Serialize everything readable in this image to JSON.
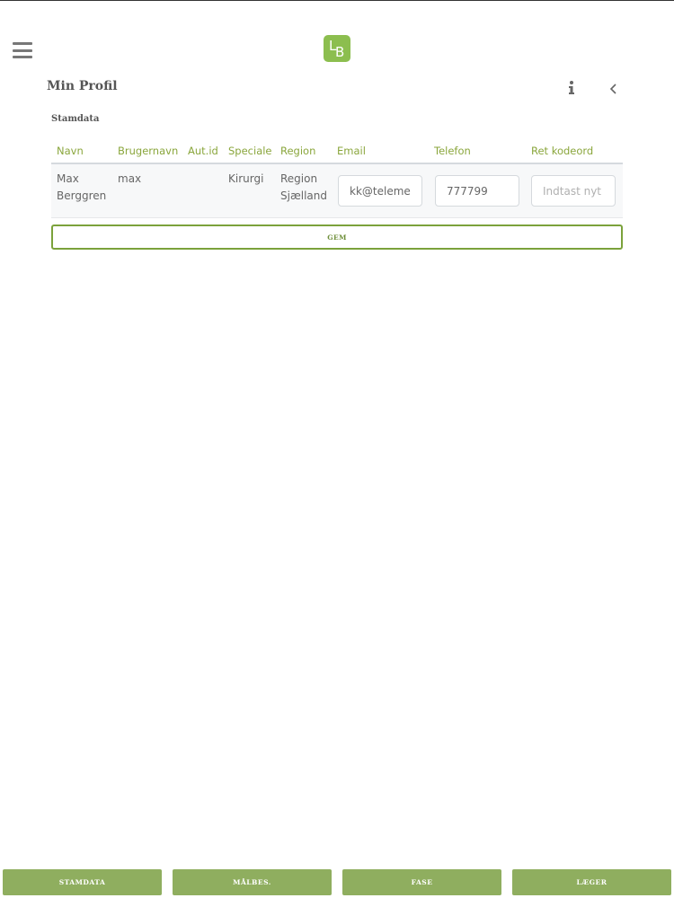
{
  "header": {
    "logo_left": "L",
    "logo_right": "B"
  },
  "page": {
    "title": "Min Profil"
  },
  "section": {
    "title": "Stamdata"
  },
  "table": {
    "headers": [
      "Navn",
      "Brugernavn",
      "Aut.id",
      "Speciale",
      "Region",
      "Email",
      "Telefon",
      "Ret kodeord"
    ],
    "row": {
      "name_first": "Max",
      "name_last": "Berggren",
      "username": "max",
      "aut_id": "",
      "speciale": "Kirurgi",
      "region_line1": "Region",
      "region_line2": "Sjælland",
      "email_value": "kk@telemed",
      "phone_value": "777799",
      "password_placeholder": "Indtast nyt"
    }
  },
  "save_label": "GEM",
  "bottom_nav": [
    "STAMDATA",
    "MÅLBES.",
    "FASE",
    "LÆGER"
  ],
  "colors": {
    "accent": "#8cbe4f",
    "header_text": "#8aa63c",
    "nav_button": "#8fae5f"
  }
}
